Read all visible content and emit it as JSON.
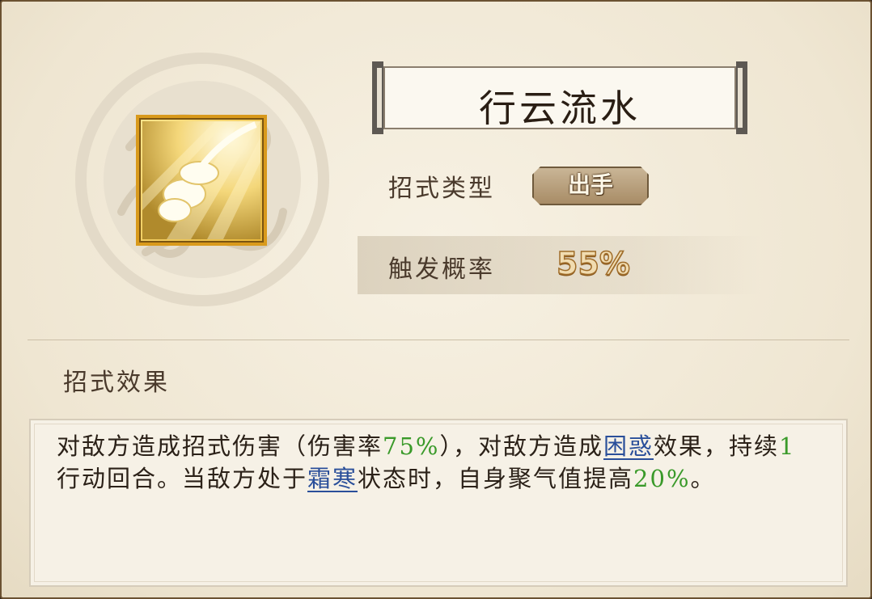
{
  "skill": {
    "name": "行云流水",
    "type_label": "招式类型",
    "type_value": "出手",
    "rate_label": "触发概率",
    "rate_value": "55%"
  },
  "effect": {
    "heading": "招式效果",
    "desc": [
      {
        "text": "对敌方造成招式伤害（伤害率",
        "style": "normal"
      },
      {
        "text": "75%",
        "style": "green"
      },
      {
        "text": "），对敌方造成",
        "style": "normal"
      },
      {
        "text": "困惑",
        "style": "link"
      },
      {
        "text": "效果，持续",
        "style": "normal"
      },
      {
        "text": "1",
        "style": "green"
      },
      {
        "text": "行动回合。当敌方处于",
        "style": "normal"
      },
      {
        "text": "霜寒",
        "style": "link"
      },
      {
        "text": "状态时，自身聚气值提高",
        "style": "normal"
      },
      {
        "text": "20%",
        "style": "green"
      },
      {
        "text": "。",
        "style": "normal"
      }
    ]
  },
  "icons": {
    "skill_icon": "flowing-cloud-icon",
    "emblem": "cloud-swirl-emblem"
  },
  "colors": {
    "highlight_green": "#3a9a2a",
    "keyword_blue": "#2a4f9a",
    "icon_frame": "#d99a1c"
  }
}
